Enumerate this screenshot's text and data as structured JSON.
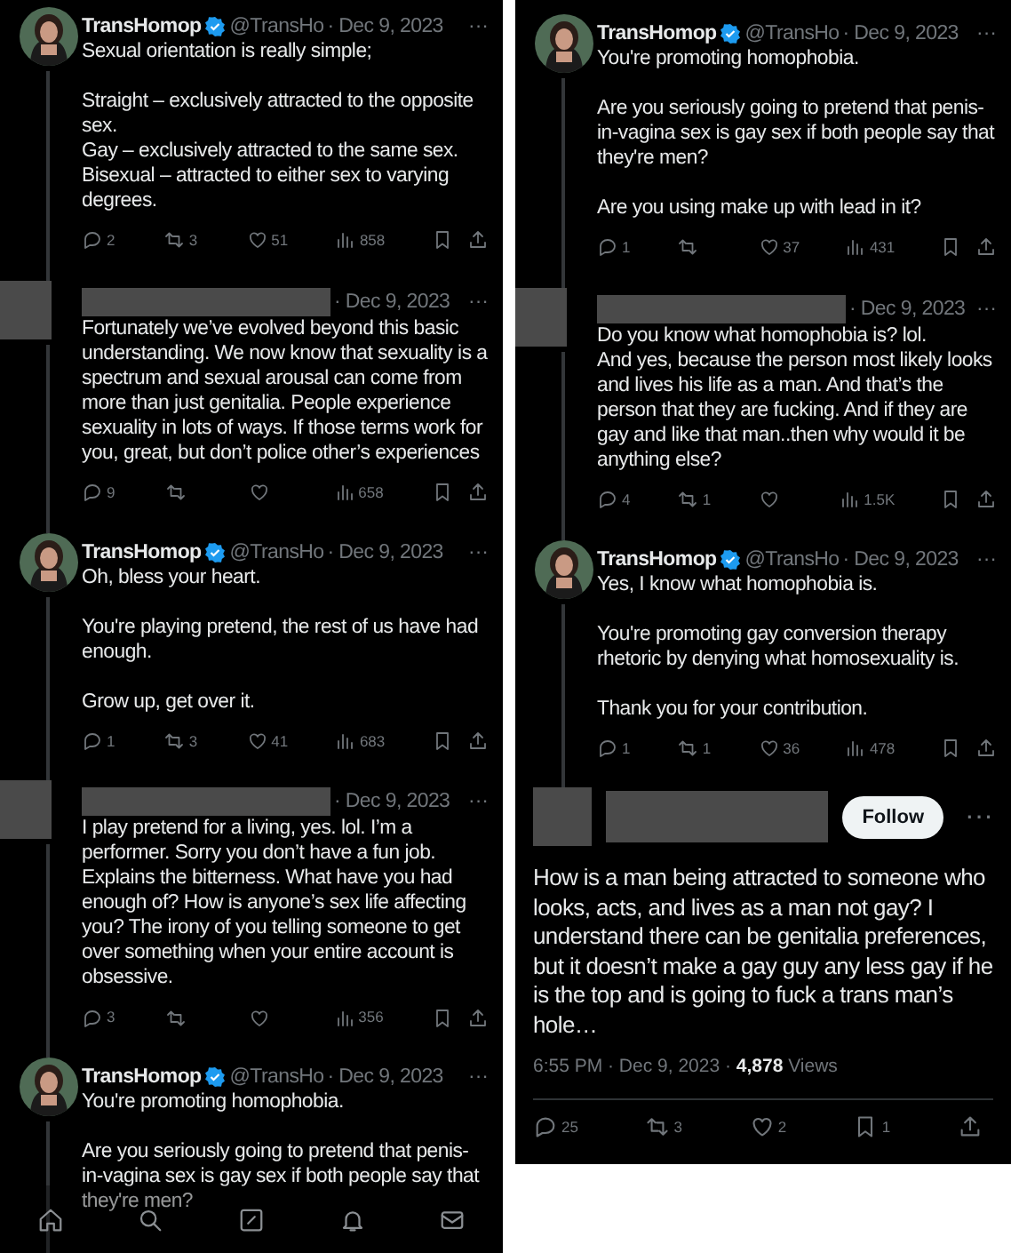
{
  "left_thread": [
    {
      "author": {
        "kind": "account",
        "name": "TransHomop",
        "handle": "@TransHo",
        "verified": true
      },
      "date": "· Dec 9, 2023",
      "more": "···",
      "paragraphs": [
        "Sexual orientation is really simple;",
        "Straight – exclusively attracted to the opposite sex.\nGay – exclusively attracted to the same sex.\nBisexual – attracted to either sex to varying degrees."
      ],
      "stats": {
        "replies": "2",
        "reposts": "3",
        "likes": "51",
        "views": "858"
      }
    },
    {
      "author": {
        "kind": "redacted"
      },
      "date": "· Dec 9, 2023",
      "more": "···",
      "paragraphs": [
        "Fortunately we’ve evolved beyond this basic understanding. We now know that sexuality is a spectrum and sexual arousal can come from more than just genitalia. People experience sexuality in lots of ways. If those terms work for you, great, but don’t police other’s experiences"
      ],
      "stats": {
        "replies": "9",
        "views": "658"
      }
    },
    {
      "author": {
        "kind": "account",
        "name": "TransHomop",
        "handle": "@TransHo",
        "verified": true
      },
      "date": "· Dec 9, 2023",
      "more": "···",
      "paragraphs": [
        "Oh, bless your heart.",
        "You're playing pretend, the rest of us have had enough.",
        "Grow up, get over it."
      ],
      "stats": {
        "replies": "1",
        "reposts": "3",
        "likes": "41",
        "views": "683"
      }
    },
    {
      "author": {
        "kind": "redacted"
      },
      "date": "· Dec 9, 2023",
      "more": "···",
      "paragraphs": [
        "I play pretend for a living, yes. lol. I’m a performer. Sorry you don’t have a fun job. Explains the bitterness. What have you had enough of? How is anyone’s sex life affecting you? The irony of you telling someone to get over something when your entire account is obsessive."
      ],
      "stats": {
        "replies": "3",
        "views": "356"
      }
    },
    {
      "author": {
        "kind": "account",
        "name": "TransHomop",
        "handle": "@TransHo",
        "verified": true
      },
      "date": "· Dec 9, 2023",
      "more": "···",
      "paragraphs": [
        "You're promoting homophobia.",
        "Are you seriously going to pretend that penis-in-vagina sex is gay sex if both people say that they're men?"
      ]
    }
  ],
  "right_thread": [
    {
      "author": {
        "kind": "account",
        "name": "TransHomop",
        "handle": "@TransHo",
        "verified": true
      },
      "date": "· Dec 9, 2023",
      "more": "···",
      "paragraphs": [
        "You're promoting homophobia.",
        "Are you seriously going to pretend that penis-in-vagina sex is gay sex if both people say that they're men?",
        "Are you using make up with lead in it?"
      ],
      "stats": {
        "replies": "1",
        "likes": "37",
        "views": "431"
      }
    },
    {
      "author": {
        "kind": "redacted"
      },
      "date": "· Dec 9, 2023",
      "more": "···",
      "paragraphs": [
        "Do you know what homophobia is? lol.\nAnd yes, because the person most likely looks and lives his life as a man. And that’s the person that they are fucking. And if they are gay and like that man..then why would it be anything else?"
      ],
      "stats": {
        "replies": "4",
        "reposts": "1",
        "views": "1.5K"
      }
    },
    {
      "author": {
        "kind": "account",
        "name": "TransHomop",
        "handle": "@TransHo",
        "verified": true
      },
      "date": "· Dec 9, 2023",
      "more": "···",
      "paragraphs": [
        "Yes, I know what homophobia is.",
        "You're promoting gay conversion therapy rhetoric by denying what homosexuality is.",
        "Thank you for your contribution."
      ],
      "stats": {
        "replies": "1",
        "reposts": "1",
        "likes": "36",
        "views": "478"
      }
    }
  ],
  "main_post": {
    "author": {
      "kind": "redacted"
    },
    "follow": "Follow",
    "more": "···",
    "text": "How is a man being attracted to someone who looks, acts, and lives as a man not gay? I understand there can be genitalia preferences, but it doesn’t make a gay guy any less gay if he is the top and is going to fuck a trans man’s hole…",
    "time": "6:55 PM · Dec 9, 2023 ·",
    "views_count": "4,878",
    "views_label": "Views",
    "stats": {
      "replies": "25",
      "reposts": "3",
      "likes": "2",
      "bookmarks": "1"
    }
  }
}
